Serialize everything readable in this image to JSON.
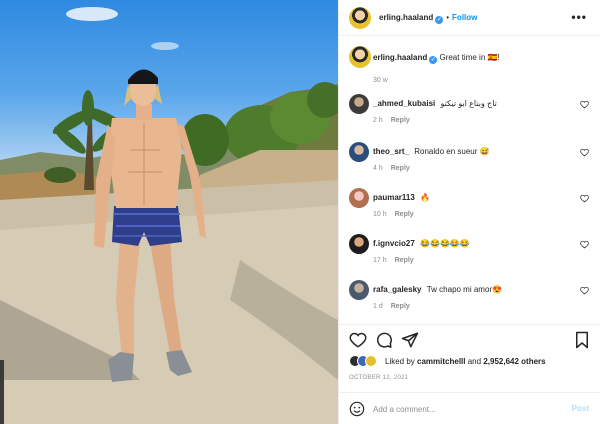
{
  "header": {
    "username": "erling.haaland",
    "follow_label": "Follow",
    "separator": "•",
    "more_icon": "more-horizontal-icon"
  },
  "caption": {
    "username": "erling.haaland",
    "text": "Great time in 🇪🇸!",
    "time": "30 w"
  },
  "comments": [
    {
      "username": "_ahmed_kubaisi",
      "text": "تاج وبتاع ابو تيكتو",
      "time": "2 h",
      "reply": "Reply"
    },
    {
      "username": "theo_srt_",
      "text": "Ronaldo en sueur 😅",
      "time": "4 h",
      "reply": "Reply"
    },
    {
      "username": "paumar113",
      "text": "🔥",
      "time": "10 h",
      "reply": "Reply"
    },
    {
      "username": "f.ignvcio27",
      "text": "😂😂😂😂😂",
      "time": "17 h",
      "reply": "Reply"
    },
    {
      "username": "rafa_galesky",
      "text": "Tw chapo mi amor😍",
      "time": "1 d",
      "reply": "Reply"
    }
  ],
  "likes": {
    "prefix": "Liked by",
    "liker": "cammitchelll",
    "joiner": "and",
    "count": "2,952,642 others"
  },
  "date": "OCTOBER 12, 2021",
  "composer": {
    "placeholder": "Add a comment...",
    "post_label": "Post"
  },
  "colors": {
    "accent": "#0095f6",
    "text": "#262626",
    "muted": "#8e8e8e",
    "post_disabled": "#b2dffc"
  }
}
